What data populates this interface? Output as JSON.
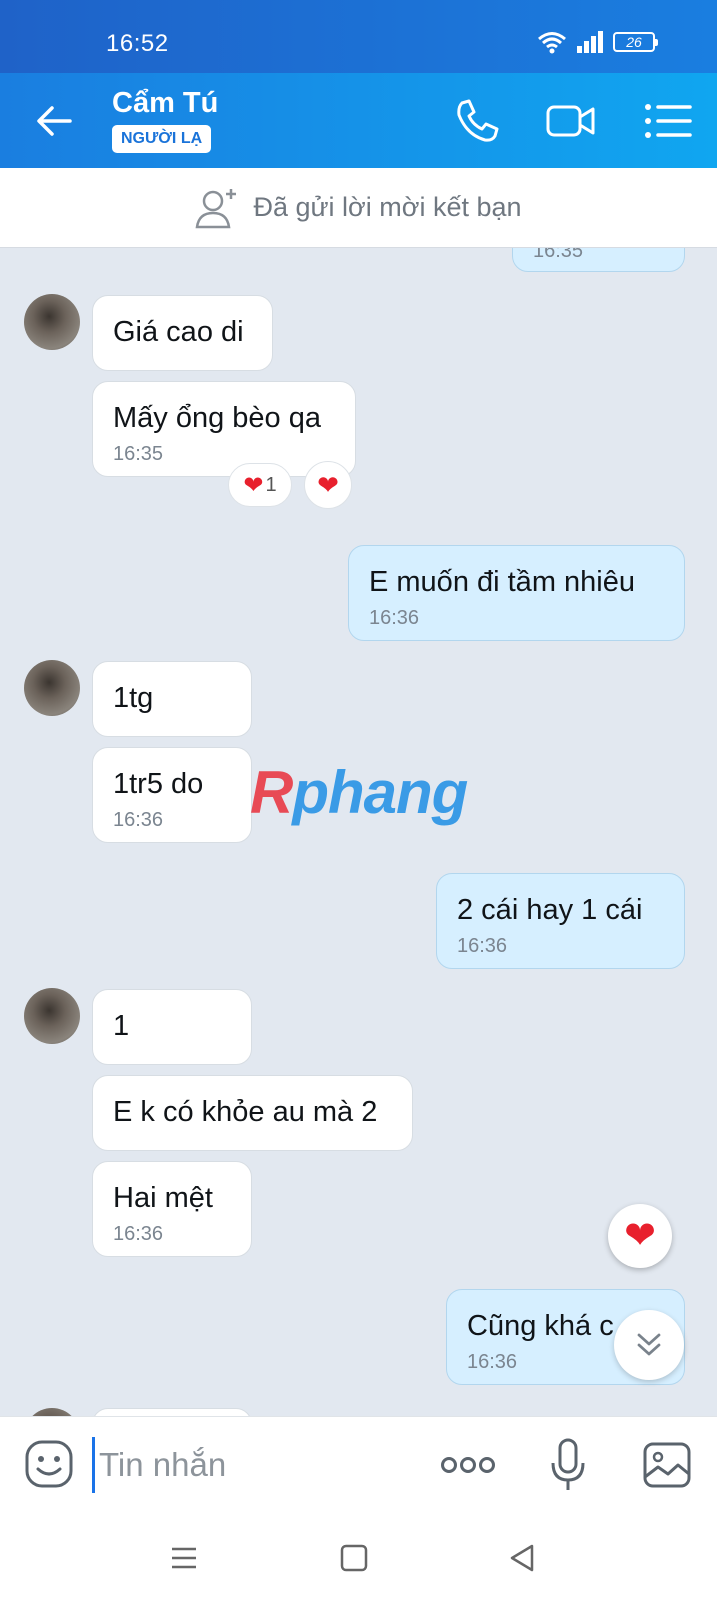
{
  "status_bar": {
    "time": "16:52",
    "battery": "26"
  },
  "header": {
    "contact_name": "Cẩm Tú",
    "badge": "NGƯỜI LẠ",
    "icons": [
      "back-arrow-icon",
      "phone-icon",
      "video-camera-icon",
      "menu-list-icon"
    ]
  },
  "friend_request": {
    "label": "Đã gửi lời mời kết bạn",
    "icon": "add-friend-icon"
  },
  "messages": [
    {
      "dir": "out",
      "text": "",
      "time": "16:35"
    },
    {
      "dir": "in",
      "text": "Giá cao di",
      "time": ""
    },
    {
      "dir": "in",
      "text": "Mấy ổng bèo qa",
      "time": "16:35",
      "reaction_count": "1"
    },
    {
      "dir": "out",
      "text": "E muốn đi tầm nhiêu",
      "time": "16:36"
    },
    {
      "dir": "in",
      "text": "1tg",
      "time": ""
    },
    {
      "dir": "in",
      "text": "1tr5 do",
      "time": "16:36"
    },
    {
      "dir": "out",
      "text": "2 cái hay 1 cái",
      "time": "16:36"
    },
    {
      "dir": "in",
      "text": "1",
      "time": ""
    },
    {
      "dir": "in",
      "text": "E k có khỏe au mà 2",
      "time": ""
    },
    {
      "dir": "in",
      "text": "Hai mệt",
      "time": "16:36"
    },
    {
      "dir": "out",
      "text": "Cũng khá c",
      "time": "16:36"
    }
  ],
  "watermark": {
    "part1": "R",
    "part2": "phang"
  },
  "input_bar": {
    "placeholder": "Tin nhắn",
    "icons": [
      "emoji-icon",
      "more-dots-icon",
      "microphone-icon",
      "image-icon"
    ]
  },
  "colors": {
    "header_start": "#1a7ee0",
    "header_end": "#10a6f0",
    "outgoing_bubble": "#d6efff",
    "chat_bg": "#e2e8f0"
  }
}
